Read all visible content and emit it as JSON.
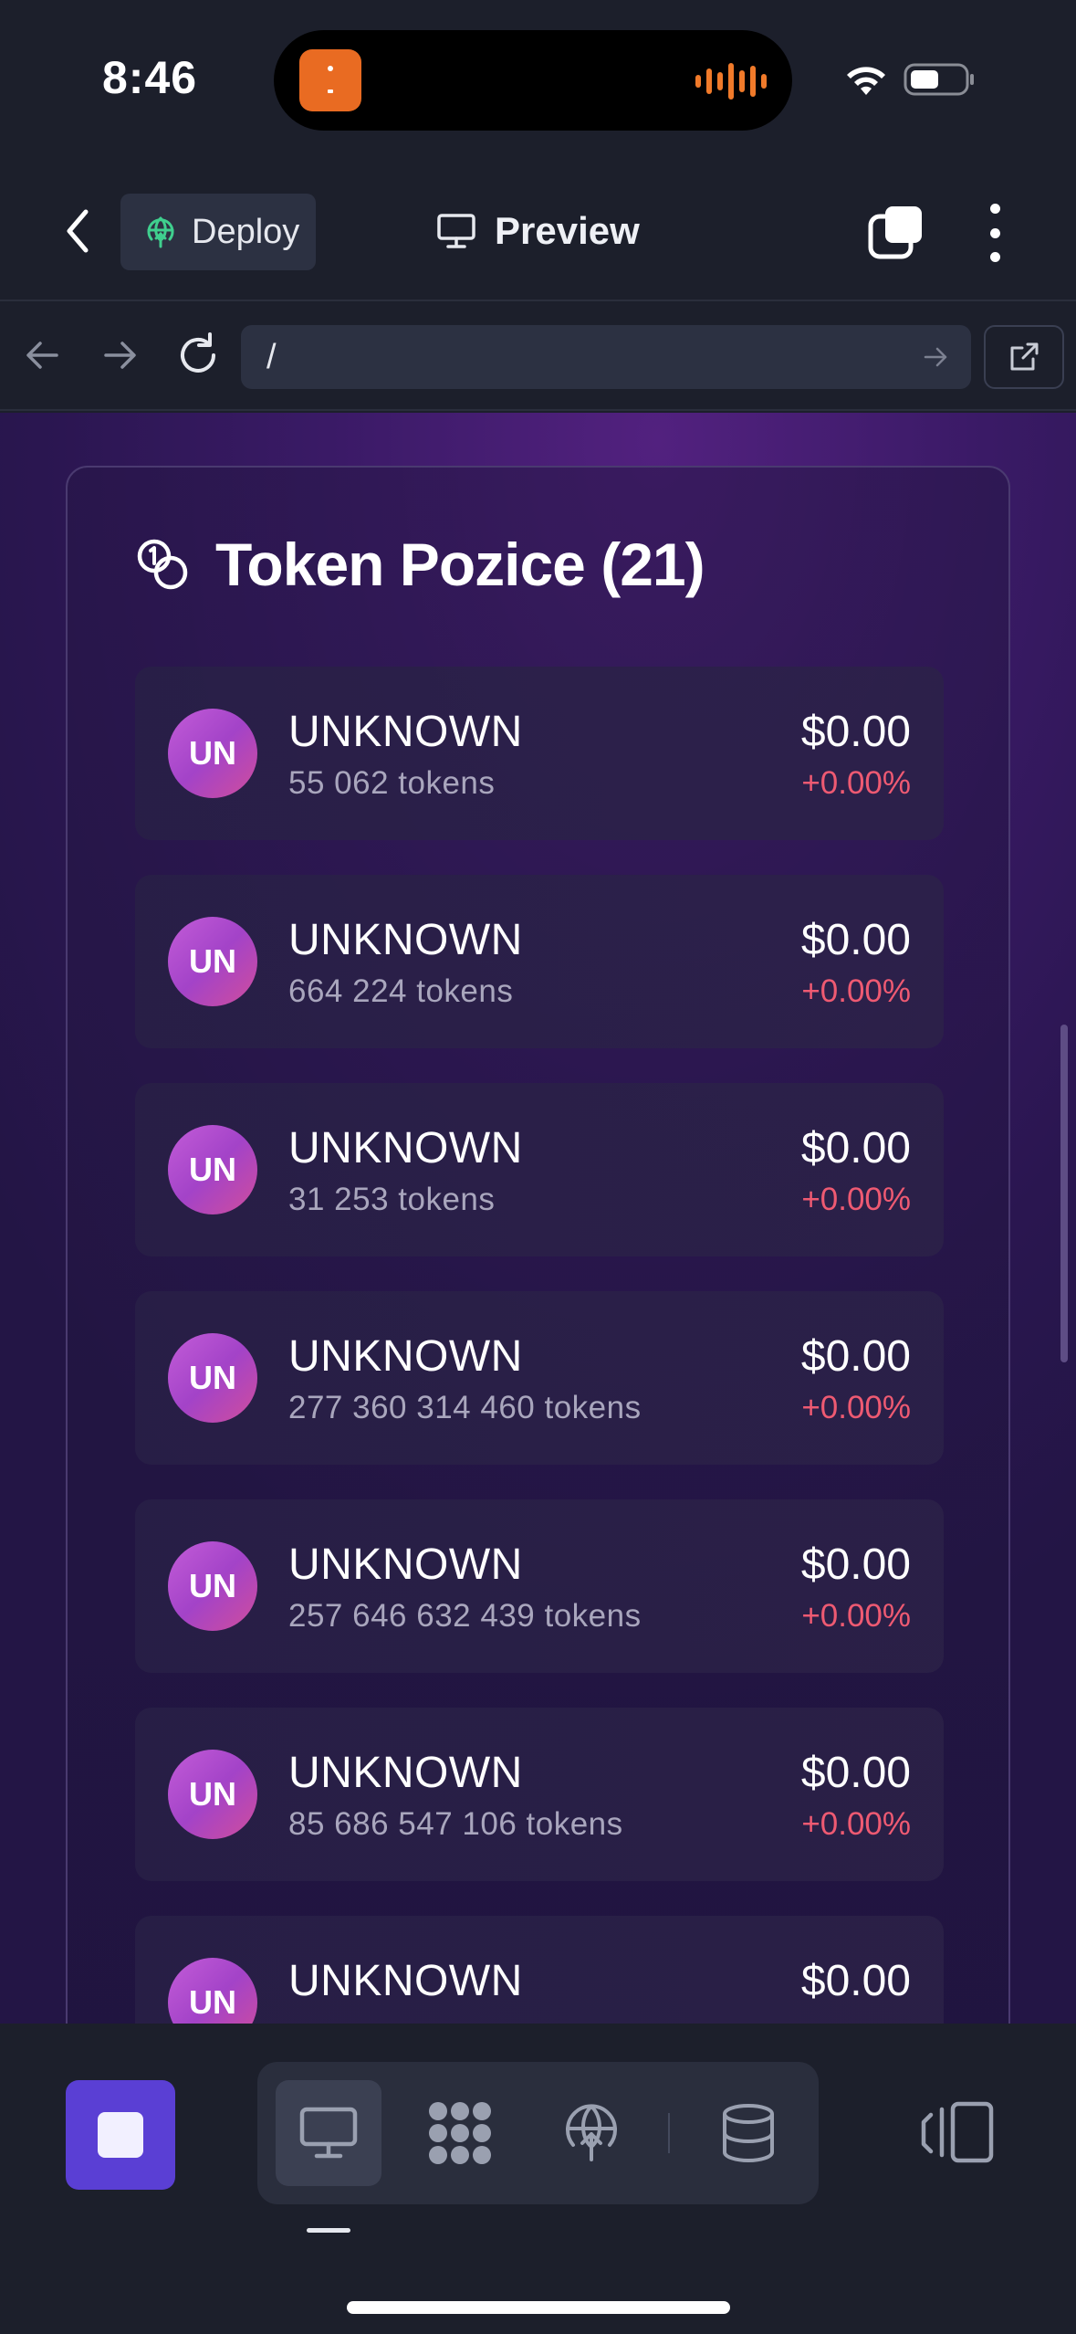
{
  "status_bar": {
    "time": "8:46"
  },
  "header": {
    "deploy_label": "Deploy",
    "preview_label": "Preview"
  },
  "browser": {
    "url": "/"
  },
  "panel": {
    "title": "Token Pozice (21)",
    "tokens": [
      {
        "avatar": "UN",
        "name": "UNKNOWN",
        "amount": "55 062 tokens",
        "value": "$0.00",
        "change": "+0.00%"
      },
      {
        "avatar": "UN",
        "name": "UNKNOWN",
        "amount": "664 224 tokens",
        "value": "$0.00",
        "change": "+0.00%"
      },
      {
        "avatar": "UN",
        "name": "UNKNOWN",
        "amount": "31 253 tokens",
        "value": "$0.00",
        "change": "+0.00%"
      },
      {
        "avatar": "UN",
        "name": "UNKNOWN",
        "amount": "277 360 314 460 tokens",
        "value": "$0.00",
        "change": "+0.00%"
      },
      {
        "avatar": "UN",
        "name": "UNKNOWN",
        "amount": "257 646 632 439 tokens",
        "value": "$0.00",
        "change": "+0.00%"
      },
      {
        "avatar": "UN",
        "name": "UNKNOWN",
        "amount": "85 686 547 106 tokens",
        "value": "$0.00",
        "change": "+0.00%"
      },
      {
        "avatar": "UN",
        "name": "UNKNOWN",
        "value": "$0.00"
      }
    ]
  },
  "colors": {
    "accent": "#5a3fd4",
    "change_negative": "#ee5a72",
    "avatar_gradient": "#c35cd8"
  },
  "icons": {
    "back": "chevron-left-icon",
    "deploy": "globe-upload-icon",
    "preview": "monitor-icon",
    "tabs": "tabs-icon",
    "more": "more-vertical-icon",
    "nav_back": "arrow-left-icon",
    "nav_forward": "arrow-right-icon",
    "reload": "reload-icon",
    "open_external": "external-link-icon",
    "coins": "coins-icon",
    "stop": "stop-icon",
    "tool_preview": "monitor-icon",
    "tool_agent": "nodes-icon",
    "tool_deploy": "globe-upload-icon",
    "tool_database": "database-icon",
    "panel_toggle": "panel-toggle-icon"
  }
}
